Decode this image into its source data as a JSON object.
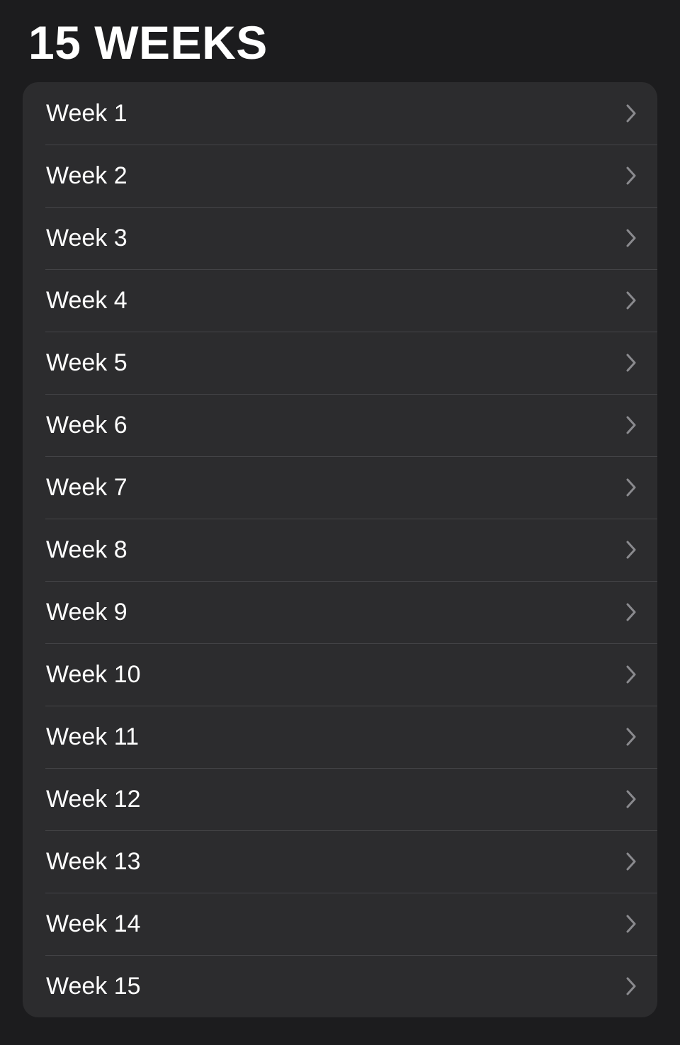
{
  "header": {
    "title": "15 WEEKS"
  },
  "weeks": [
    {
      "label": "Week 1"
    },
    {
      "label": "Week 2"
    },
    {
      "label": "Week 3"
    },
    {
      "label": "Week 4"
    },
    {
      "label": "Week 5"
    },
    {
      "label": "Week 6"
    },
    {
      "label": "Week 7"
    },
    {
      "label": "Week 8"
    },
    {
      "label": "Week 9"
    },
    {
      "label": "Week 10"
    },
    {
      "label": "Week 11"
    },
    {
      "label": "Week 12"
    },
    {
      "label": "Week 13"
    },
    {
      "label": "Week 14"
    },
    {
      "label": "Week 15"
    }
  ],
  "icons": {
    "row_disclosure": "chevron-right-icon"
  },
  "colors": {
    "background": "#1c1c1e",
    "card": "#2c2c2e",
    "separator": "#444447",
    "text": "#ffffff",
    "chevron": "#8a8a8e"
  }
}
